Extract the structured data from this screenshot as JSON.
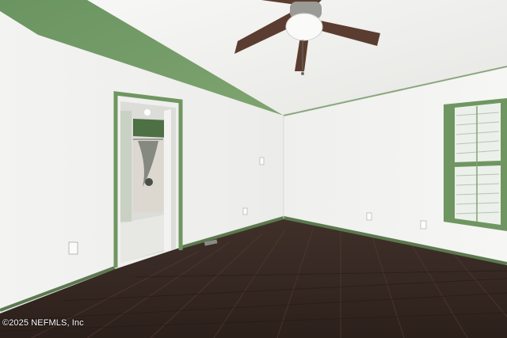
{
  "photo": {
    "watermark": "©2025 NEFMLS, Inc",
    "colors": {
      "wall_white": "#f1f1ef",
      "wall_green": "#6f9661",
      "trim_green": "#5b7a4f",
      "ceiling": "#f4f4f2",
      "floor": "#3a2b24",
      "fan_blade": "#5a3d30"
    }
  }
}
